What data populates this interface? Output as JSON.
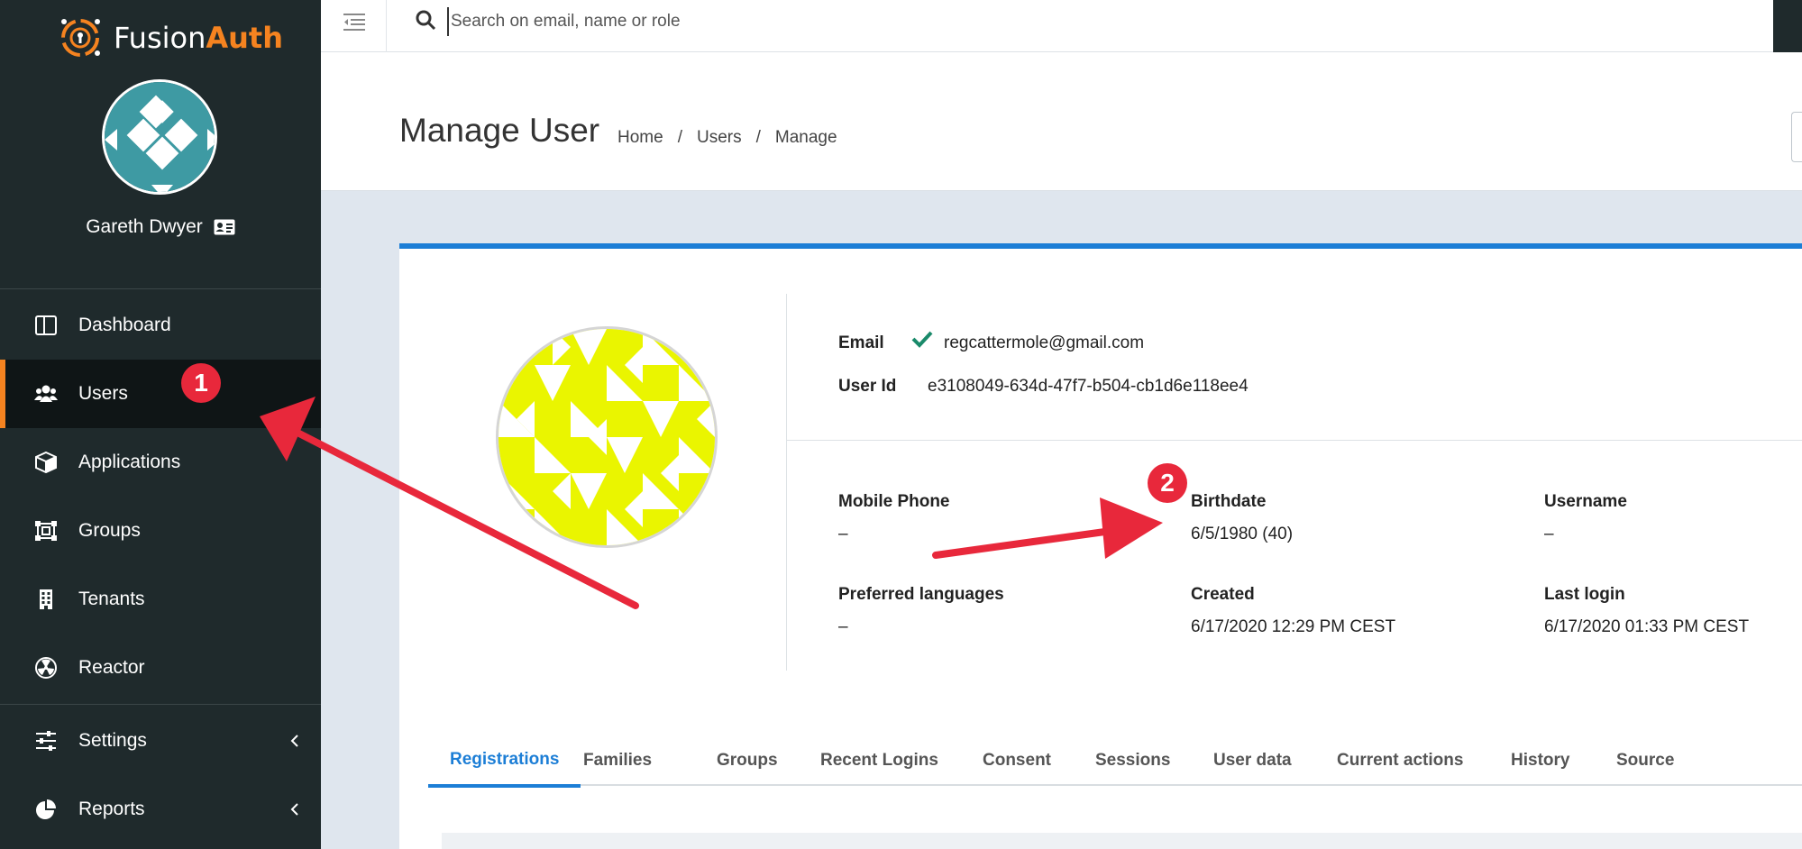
{
  "brand": {
    "name_part1": "Fusion",
    "name_part2": "Auth",
    "accent": "#f58320"
  },
  "sidebar": {
    "user_name": "Gareth Dwyer",
    "items": [
      {
        "label": "Dashboard",
        "icon": "dashboard-icon"
      },
      {
        "label": "Users",
        "icon": "users-icon",
        "active": true
      },
      {
        "label": "Applications",
        "icon": "cube-icon"
      },
      {
        "label": "Groups",
        "icon": "groups-icon"
      },
      {
        "label": "Tenants",
        "icon": "building-icon"
      },
      {
        "label": "Reactor",
        "icon": "radiation-icon"
      },
      {
        "label": "Settings",
        "icon": "sliders-icon"
      },
      {
        "label": "Reports",
        "icon": "pie-chart-icon"
      }
    ]
  },
  "search": {
    "placeholder": "Search on email, name or role"
  },
  "header": {
    "title": "Manage User",
    "breadcrumb": [
      "Home",
      "Users",
      "Manage"
    ],
    "separator": "/"
  },
  "user": {
    "email_label": "Email",
    "email": "regcattermole@gmail.com",
    "user_id_label": "User Id",
    "user_id": "e3108049-634d-47f7-b504-cb1d6e118ee4",
    "mobile_phone_label": "Mobile Phone",
    "mobile_phone": "–",
    "birthdate_label": "Birthdate",
    "birthdate": "6/5/1980 (40)",
    "username_label": "Username",
    "username": "–",
    "preferred_languages_label": "Preferred languages",
    "preferred_languages": "–",
    "created_label": "Created",
    "created": "6/17/2020 12:29 PM CEST",
    "last_login_label": "Last login",
    "last_login": "6/17/2020 01:33 PM CEST"
  },
  "tabs": [
    "Registrations",
    "Families",
    "Groups",
    "Recent Logins",
    "Consent",
    "Sessions",
    "User data",
    "Current actions",
    "History",
    "Source"
  ],
  "annotations": {
    "badge1": "1",
    "badge2": "2",
    "color": "#e8283b"
  }
}
